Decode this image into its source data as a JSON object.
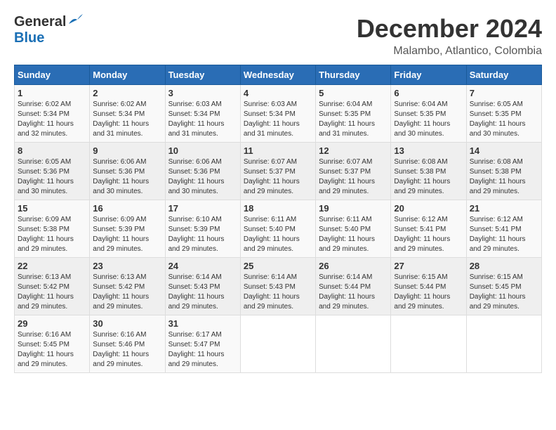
{
  "header": {
    "logo_general": "General",
    "logo_blue": "Blue",
    "month": "December 2024",
    "location": "Malambo, Atlantico, Colombia"
  },
  "weekdays": [
    "Sunday",
    "Monday",
    "Tuesday",
    "Wednesday",
    "Thursday",
    "Friday",
    "Saturday"
  ],
  "weeks": [
    [
      {
        "day": "1",
        "sunrise": "6:02 AM",
        "sunset": "5:34 PM",
        "daylight": "11 hours and 32 minutes."
      },
      {
        "day": "2",
        "sunrise": "6:02 AM",
        "sunset": "5:34 PM",
        "daylight": "11 hours and 31 minutes."
      },
      {
        "day": "3",
        "sunrise": "6:03 AM",
        "sunset": "5:34 PM",
        "daylight": "11 hours and 31 minutes."
      },
      {
        "day": "4",
        "sunrise": "6:03 AM",
        "sunset": "5:34 PM",
        "daylight": "11 hours and 31 minutes."
      },
      {
        "day": "5",
        "sunrise": "6:04 AM",
        "sunset": "5:35 PM",
        "daylight": "11 hours and 31 minutes."
      },
      {
        "day": "6",
        "sunrise": "6:04 AM",
        "sunset": "5:35 PM",
        "daylight": "11 hours and 30 minutes."
      },
      {
        "day": "7",
        "sunrise": "6:05 AM",
        "sunset": "5:35 PM",
        "daylight": "11 hours and 30 minutes."
      }
    ],
    [
      {
        "day": "8",
        "sunrise": "6:05 AM",
        "sunset": "5:36 PM",
        "daylight": "11 hours and 30 minutes."
      },
      {
        "day": "9",
        "sunrise": "6:06 AM",
        "sunset": "5:36 PM",
        "daylight": "11 hours and 30 minutes."
      },
      {
        "day": "10",
        "sunrise": "6:06 AM",
        "sunset": "5:36 PM",
        "daylight": "11 hours and 30 minutes."
      },
      {
        "day": "11",
        "sunrise": "6:07 AM",
        "sunset": "5:37 PM",
        "daylight": "11 hours and 29 minutes."
      },
      {
        "day": "12",
        "sunrise": "6:07 AM",
        "sunset": "5:37 PM",
        "daylight": "11 hours and 29 minutes."
      },
      {
        "day": "13",
        "sunrise": "6:08 AM",
        "sunset": "5:38 PM",
        "daylight": "11 hours and 29 minutes."
      },
      {
        "day": "14",
        "sunrise": "6:08 AM",
        "sunset": "5:38 PM",
        "daylight": "11 hours and 29 minutes."
      }
    ],
    [
      {
        "day": "15",
        "sunrise": "6:09 AM",
        "sunset": "5:38 PM",
        "daylight": "11 hours and 29 minutes."
      },
      {
        "day": "16",
        "sunrise": "6:09 AM",
        "sunset": "5:39 PM",
        "daylight": "11 hours and 29 minutes."
      },
      {
        "day": "17",
        "sunrise": "6:10 AM",
        "sunset": "5:39 PM",
        "daylight": "11 hours and 29 minutes."
      },
      {
        "day": "18",
        "sunrise": "6:11 AM",
        "sunset": "5:40 PM",
        "daylight": "11 hours and 29 minutes."
      },
      {
        "day": "19",
        "sunrise": "6:11 AM",
        "sunset": "5:40 PM",
        "daylight": "11 hours and 29 minutes."
      },
      {
        "day": "20",
        "sunrise": "6:12 AM",
        "sunset": "5:41 PM",
        "daylight": "11 hours and 29 minutes."
      },
      {
        "day": "21",
        "sunrise": "6:12 AM",
        "sunset": "5:41 PM",
        "daylight": "11 hours and 29 minutes."
      }
    ],
    [
      {
        "day": "22",
        "sunrise": "6:13 AM",
        "sunset": "5:42 PM",
        "daylight": "11 hours and 29 minutes."
      },
      {
        "day": "23",
        "sunrise": "6:13 AM",
        "sunset": "5:42 PM",
        "daylight": "11 hours and 29 minutes."
      },
      {
        "day": "24",
        "sunrise": "6:14 AM",
        "sunset": "5:43 PM",
        "daylight": "11 hours and 29 minutes."
      },
      {
        "day": "25",
        "sunrise": "6:14 AM",
        "sunset": "5:43 PM",
        "daylight": "11 hours and 29 minutes."
      },
      {
        "day": "26",
        "sunrise": "6:14 AM",
        "sunset": "5:44 PM",
        "daylight": "11 hours and 29 minutes."
      },
      {
        "day": "27",
        "sunrise": "6:15 AM",
        "sunset": "5:44 PM",
        "daylight": "11 hours and 29 minutes."
      },
      {
        "day": "28",
        "sunrise": "6:15 AM",
        "sunset": "5:45 PM",
        "daylight": "11 hours and 29 minutes."
      }
    ],
    [
      {
        "day": "29",
        "sunrise": "6:16 AM",
        "sunset": "5:45 PM",
        "daylight": "11 hours and 29 minutes."
      },
      {
        "day": "30",
        "sunrise": "6:16 AM",
        "sunset": "5:46 PM",
        "daylight": "11 hours and 29 minutes."
      },
      {
        "day": "31",
        "sunrise": "6:17 AM",
        "sunset": "5:47 PM",
        "daylight": "11 hours and 29 minutes."
      },
      null,
      null,
      null,
      null
    ]
  ]
}
